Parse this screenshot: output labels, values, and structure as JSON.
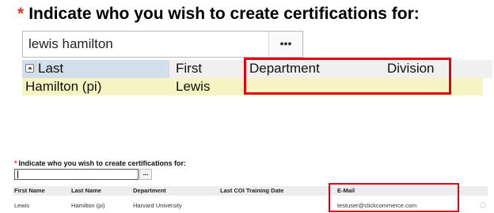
{
  "zoomed": {
    "required_mark": "*",
    "title": "Indicate who you wish to create certifications for:",
    "search_value": "lewis hamilton",
    "lookup_button": "•••",
    "columns": [
      "Last",
      "First",
      "Department",
      "Division"
    ],
    "row": {
      "last": "Hamilton (pi)",
      "first": "Lewis",
      "department": "",
      "division": ""
    }
  },
  "normal": {
    "required_mark": "*",
    "title": "Indicate who you wish to create certifications for:",
    "search_value": "",
    "lookup_button": "...",
    "columns": [
      "First Name",
      "Last Name",
      "Department",
      "Last COI Training Date",
      "E-Mail"
    ],
    "row": {
      "first_name": "Lewis",
      "last_name": "Hamilton (pi)",
      "department": "Harvard University",
      "last_coi": "",
      "email": "testuser@clickcommerce.com"
    }
  },
  "highlight_color": "#e0000f",
  "selected_row_color": "#f7f4c4"
}
